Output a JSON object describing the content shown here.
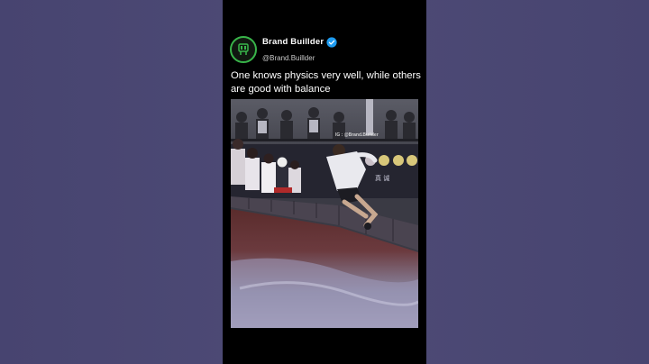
{
  "post": {
    "display_name": "Brand Buillder",
    "handle": "@Brand.Buillder",
    "verified_icon": "verified-badge-icon",
    "text": "One knows physics very well, while others are good with balance"
  },
  "video": {
    "watermark": "IG : @Brand.Builder",
    "sign_text": "真 诚"
  },
  "colors": {
    "background": "#4b4872",
    "card": "#000000",
    "verified": "#1d9bf0",
    "avatar_ring": "#39b54a"
  }
}
